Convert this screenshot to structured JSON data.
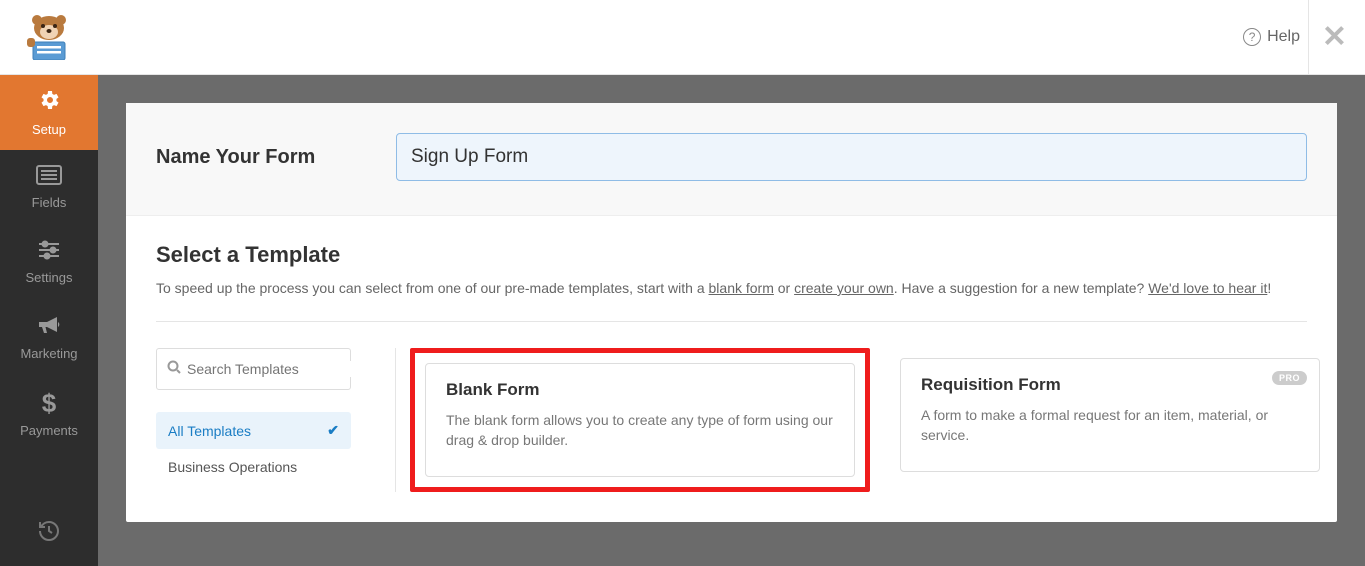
{
  "topbar": {
    "help_label": "Help"
  },
  "sidebar": {
    "items": [
      {
        "icon": "gear",
        "label": "Setup"
      },
      {
        "icon": "list",
        "label": "Fields"
      },
      {
        "icon": "sliders",
        "label": "Settings"
      },
      {
        "icon": "bullhorn",
        "label": "Marketing"
      },
      {
        "icon": "dollar",
        "label": "Payments"
      }
    ]
  },
  "form": {
    "name_label": "Name Your Form",
    "name_value": "Sign Up Form"
  },
  "templates": {
    "heading": "Select a Template",
    "desc_parts": {
      "p1": "To speed up the process you can select from one of our pre-made templates, start with a ",
      "link1": "blank form",
      "p2": " or ",
      "link2": "create your own",
      "p3": ". Have a suggestion for a new template? ",
      "link3": "We'd love to hear it",
      "p4": "!"
    },
    "search_placeholder": "Search Templates",
    "categories": [
      {
        "label": "All Templates",
        "active": true
      },
      {
        "label": "Business Operations",
        "active": false
      }
    ],
    "cards": [
      {
        "title": "Blank Form",
        "desc": "The blank form allows you to create any type of form using our drag & drop builder.",
        "pro": false,
        "highlighted": true
      },
      {
        "title": "Requisition Form",
        "desc": "A form to make a formal request for an item, material, or service.",
        "pro": true,
        "highlighted": false
      }
    ],
    "pro_label": "PRO"
  }
}
